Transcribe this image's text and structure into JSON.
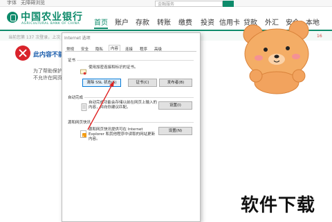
{
  "top": {
    "left_links": [
      "字体",
      "无障碍浏览"
    ],
    "search_placeholder": "金融服务"
  },
  "header": {
    "bank_name": "中国农业银行",
    "bank_name_en": "AGRICULTURAL BANK OF CHINA",
    "nav": [
      "首页",
      "账户",
      "存款",
      "转账",
      "缴费",
      "投资",
      "信用卡",
      "贷款",
      "外汇",
      "安全",
      "本地"
    ],
    "active_nav": "首页",
    "login_info": "当前您第 137 次登录，上次",
    "page_suffix": "16"
  },
  "error": {
    "title": "此内容不能显",
    "line1": "为了帮助保护",
    "line2": "不允许在网页"
  },
  "dialog": {
    "title": "Internet 选项",
    "tabs": [
      "常规",
      "安全",
      "隐私",
      "内容",
      "连接",
      "程序",
      "高级"
    ],
    "active_tab": "内容",
    "cert_section": "证书",
    "cert_desc": "使用加密连接和标识的证书。",
    "btn_clear_ssl": "清除 SSL 状态(S)",
    "btn_certs": "证书(C)",
    "btn_publishers": "发布者(B)",
    "autocomplete_section": "自动完成",
    "autocomplete_desc_1": "自动完成功能会存储以前在网页上输入的",
    "autocomplete_desc_2": "内容，并向你建议匹配。",
    "btn_settings_1": "设置(I)",
    "feeds_section": "源和网页快讯",
    "feeds_desc_1": "源和网页快讯提供可在 Internet",
    "feeds_desc_2": "Explorer 和其他程序中读取的网站更新",
    "feeds_desc_3": "内容。",
    "btn_settings_2": "设置(N)"
  },
  "watermark": "软件下载",
  "colors": {
    "brand": "#0e8b6b",
    "error": "#d9232b",
    "bear": "#f2a35e",
    "arrow": "#e02020"
  }
}
